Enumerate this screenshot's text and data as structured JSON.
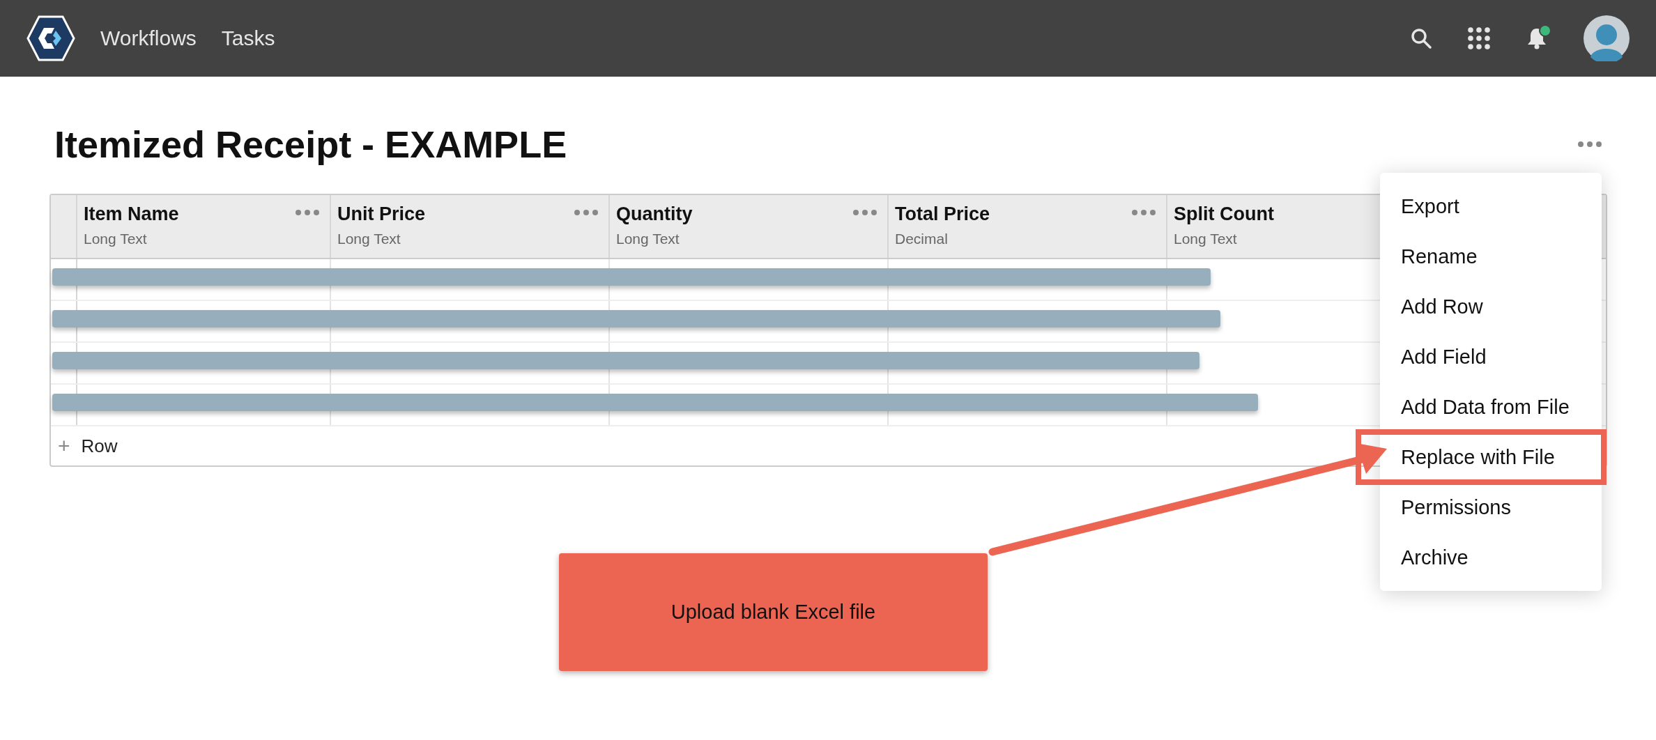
{
  "navbar": {
    "links": [
      {
        "label": "Workflows"
      },
      {
        "label": "Tasks"
      }
    ],
    "notifications": {
      "unread": true
    }
  },
  "page": {
    "title": "Itemized Receipt - EXAMPLE"
  },
  "table": {
    "columns": [
      {
        "name": "Item Name",
        "type": "Long Text"
      },
      {
        "name": "Unit Price",
        "type": "Long Text"
      },
      {
        "name": "Quantity",
        "type": "Long Text"
      },
      {
        "name": "Total Price",
        "type": "Decimal"
      },
      {
        "name": "Split Count",
        "type": "Long Text"
      }
    ],
    "rows": [
      {
        "kind": "redacted"
      },
      {
        "kind": "redacted"
      },
      {
        "kind": "redacted"
      },
      {
        "kind": "redacted"
      }
    ],
    "add_row": {
      "icon": "+",
      "label": "Row"
    }
  },
  "menu": {
    "items": [
      {
        "label": "Export",
        "highlighted": false
      },
      {
        "label": "Rename",
        "highlighted": false
      },
      {
        "label": "Add Row",
        "highlighted": false
      },
      {
        "label": "Add Field",
        "highlighted": false
      },
      {
        "label": "Add Data from File",
        "highlighted": false
      },
      {
        "label": "Replace with File",
        "highlighted": true
      },
      {
        "label": "Permissions",
        "highlighted": false
      },
      {
        "label": "Archive",
        "highlighted": false
      }
    ]
  },
  "callout": {
    "text": "Upload blank Excel file"
  }
}
